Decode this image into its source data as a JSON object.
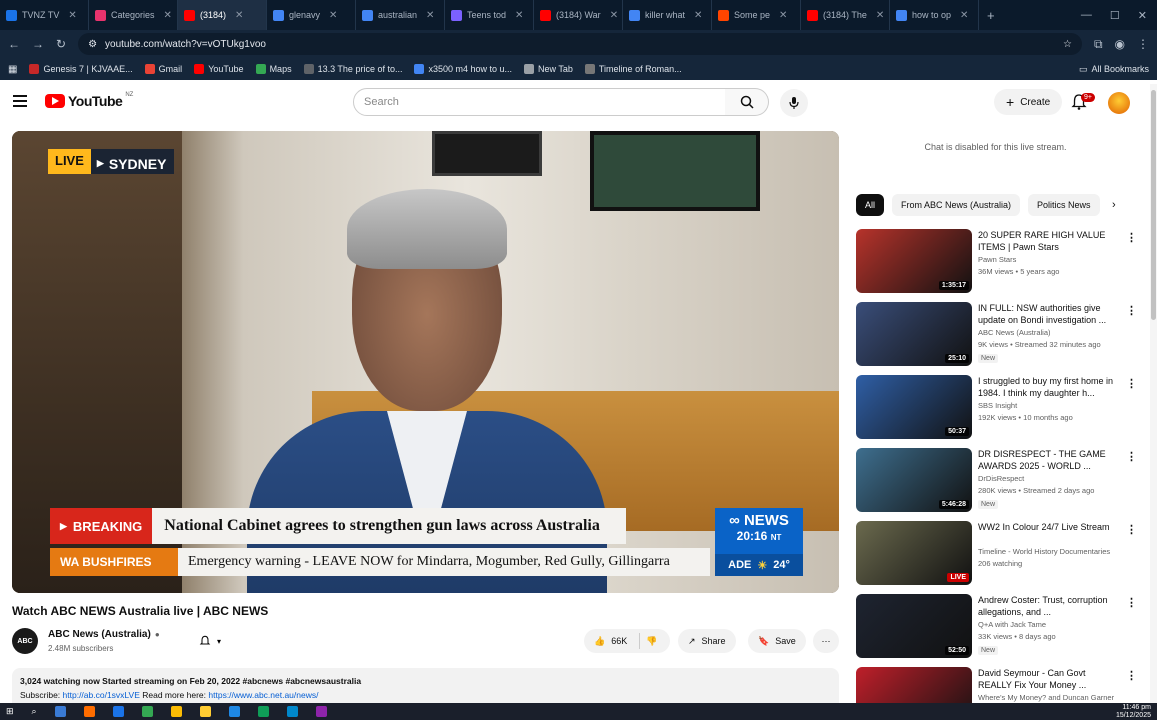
{
  "browser": {
    "tabs": [
      {
        "label": "TVNZ TV",
        "color": "#1a73e8",
        "active": false
      },
      {
        "label": "Categories",
        "color": "#e8336d",
        "active": false
      },
      {
        "label": "(3184)",
        "color": "#ff0000",
        "active": true
      },
      {
        "label": "glenavy",
        "color": "#4285f4",
        "active": false
      },
      {
        "label": "australian",
        "color": "#4285f4",
        "active": false
      },
      {
        "label": "Teens tod",
        "color": "#7b61ff",
        "active": false
      },
      {
        "label": "(3184) War",
        "color": "#ff0000",
        "active": false
      },
      {
        "label": "killer what",
        "color": "#4285f4",
        "active": false
      },
      {
        "label": "Some pe",
        "color": "#ff4500",
        "active": false
      },
      {
        "label": "(3184) The",
        "color": "#ff0000",
        "active": false
      },
      {
        "label": "how to op",
        "color": "#4285f4",
        "active": false
      }
    ],
    "url": "youtube.com/watch?v=vOTUkg1voo",
    "bookmarks": [
      {
        "label": "Genesis 7 | KJVAAE...",
        "color": "#c62828"
      },
      {
        "label": "Gmail",
        "color": "#ea4335"
      },
      {
        "label": "YouTube",
        "color": "#ff0000"
      },
      {
        "label": "Maps",
        "color": "#34a853"
      },
      {
        "label": "13.3 The price of to...",
        "color": "#5f6368"
      },
      {
        "label": "x3500 m4 how to u...",
        "color": "#4285f4"
      },
      {
        "label": "New Tab",
        "color": "#9aa0a6"
      },
      {
        "label": "Timeline of Roman...",
        "color": "#777777"
      }
    ],
    "all_bookmarks": "All Bookmarks"
  },
  "header": {
    "logo_text": "YouTube",
    "country": "NZ",
    "search_placeholder": "Search",
    "create_label": "Create",
    "notif_badge": "9+"
  },
  "video": {
    "live_label": "LIVE",
    "location": "SYDNEY",
    "breaking_label": "BREAKING",
    "breaking_text": "National Cabinet agrees to strengthen gun laws across Australia",
    "alert_label": "WA BUSHFIRES",
    "alert_text": "Emergency warning - LEAVE NOW for Mindarra, Mogumber, Red Gully, Gillingarra",
    "brand": "NEWS",
    "time": "20:16",
    "tz": "NT",
    "weather_city": "ADE",
    "weather_temp": "24°"
  },
  "meta": {
    "title": "Watch ABC NEWS Australia live | ABC NEWS",
    "channel": "ABC News (Australia)",
    "subscribers": "2.48M subscribers",
    "likes": "66K",
    "share": "Share",
    "save": "Save",
    "watching": "3,024 watching now  Started streaming on Feb 20, 2022  #abcnews #abcnewsaustralia",
    "subscribe_prefix": "Subscribe: ",
    "subscribe_link": "http://ab.co/1svxLVE",
    "read_more_prefix": "  Read more here: ",
    "read_more_link": "https://www.abc.net.au/news/"
  },
  "sidebar": {
    "chat_disabled": "Chat is disabled for this live stream.",
    "chips": [
      "All",
      "From ABC News (Australia)",
      "Politics News"
    ],
    "recs": [
      {
        "title": "20 SUPER RARE HIGH VALUE ITEMS | Pawn Stars",
        "channel": "Pawn Stars",
        "meta": "36M views • 5 years ago",
        "duration": "1:35:17",
        "new": "",
        "thumb": "#b7332b"
      },
      {
        "title": "IN FULL: NSW authorities give update on Bondi investigation ...",
        "channel": "ABC News (Australia)",
        "meta": "9K views • Streamed 32 minutes ago",
        "duration": "25:10",
        "new": "New",
        "thumb": "#3a4e7a"
      },
      {
        "title": "I struggled to buy my first home in 1984. I think my daughter h...",
        "channel": "SBS Insight",
        "meta": "192K views • 10 months ago",
        "duration": "50:37",
        "new": "",
        "thumb": "#2f5fa6"
      },
      {
        "title": "DR DISRESPECT - THE GAME AWARDS 2025 - WORLD ...",
        "channel": "DrDisRespect",
        "meta": "280K views • Streamed 2 days ago",
        "duration": "5:46:28",
        "new": "New",
        "thumb": "#3e6f8f"
      },
      {
        "title": "WW2 In Colour 24/7 Live Stream",
        "channel": "Timeline - World History Documentaries",
        "meta": "206 watching",
        "duration": "LIVE",
        "new": "",
        "thumb": "#6b6a4e"
      },
      {
        "title": "Andrew Coster: Trust, corruption allegations, and ...",
        "channel": "Q+A with Jack Tame",
        "meta": "33K views • 8 days ago",
        "duration": "52:50",
        "new": "New",
        "thumb": "#1e2431"
      },
      {
        "title": "David Seymour - Can Govt REALLY Fix Your Money ...",
        "channel": "Where's My Money? and Duncan Garner",
        "meta": "",
        "duration": "",
        "new": "",
        "thumb": "#bf1f2a"
      }
    ]
  },
  "taskbar": {
    "time": "11:46 pm",
    "date": "15/12/2025"
  }
}
